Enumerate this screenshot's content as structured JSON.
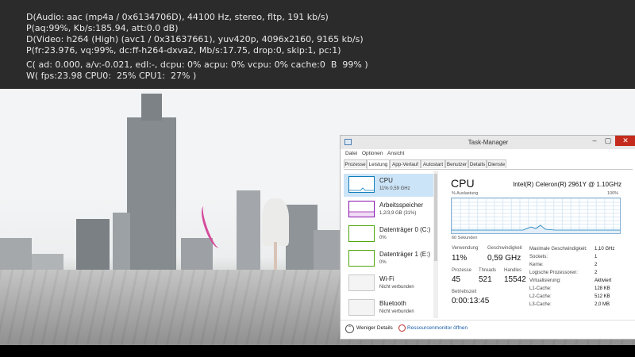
{
  "osd": {
    "line1": "D(Audio: aac (mp4a / 0x6134706D), 44100 Hz, stereo, fltp, 191 kb/s)",
    "line2": "P(aq:99%, Kb/s:185.94, att:0.0 dB)",
    "line3": "D(Video: h264 (High) (avc1 / 0x31637661), yuv420p, 4096x2160, 9165 kb/s)",
    "line4": "P(fr:23.976, vq:99%, dc:ff-h264-dxva2, Mb/s:17.75, drop:0, skip:1, pc:1)",
    "line5": "C( ad: 0.000, a/v:-0.021, edl:-, dcpu: 0% acpu: 0% vcpu: 0% cache:0  B  99% )",
    "line6": "W( fps:23.98 CPU0:  25% CPU1:  27% )"
  },
  "taskmanager": {
    "title": "Task-Manager",
    "window_buttons": {
      "minimize": "–",
      "maximize": "▢",
      "close": "✕"
    },
    "menu": [
      "Datei",
      "Optionen",
      "Ansicht"
    ],
    "tabs": [
      "Prozesse",
      "Leistung",
      "App-Verlauf",
      "Autostart",
      "Benutzer",
      "Details",
      "Dienste"
    ],
    "active_tab": "Leistung",
    "resources": [
      {
        "name": "CPU",
        "sub": "11% 0,59 GHz",
        "color": "#117dbb",
        "selected": true
      },
      {
        "name": "Arbeitsspeicher",
        "sub": "1,2/3,9 GB (31%)",
        "color": "#8b12ae",
        "selected": false
      },
      {
        "name": "Datenträger 0 (C:)",
        "sub": "0%",
        "color": "#4da60c",
        "selected": false
      },
      {
        "name": "Datenträger 1 (E:)",
        "sub": "0%",
        "color": "#4da60c",
        "selected": false
      },
      {
        "name": "Wi-Fi",
        "sub": "Nicht verbunden",
        "color": "#a74f01",
        "selected": false
      },
      {
        "name": "Bluetooth",
        "sub": "Nicht verbunden",
        "color": "#a74f01",
        "selected": false
      }
    ],
    "detail": {
      "title": "CPU",
      "model": "Intel(R) Celeron(R) 2961Y @ 1.10GHz",
      "graph_label": "% Auslastung",
      "graph_max": "100%",
      "graph_time": "60 Sekunden",
      "stats": {
        "usage_label": "Verwendung",
        "usage_value": "11%",
        "speed_label": "Geschwindigkeit",
        "speed_value": "0,59 GHz",
        "processes_label": "Prozesse",
        "processes_value": "45",
        "threads_label": "Threads",
        "threads_value": "521",
        "handles_label": "Handles",
        "handles_value": "15542",
        "uptime_label": "Betriebszeit",
        "uptime_value": "0:00:13:45"
      },
      "specs": [
        {
          "key": "Maximale Geschwindigkeit:",
          "value": "1,10 GHz"
        },
        {
          "key": "Sockets:",
          "value": "1"
        },
        {
          "key": "Kerne:",
          "value": "2"
        },
        {
          "key": "Logische Prozessoren:",
          "value": "2"
        },
        {
          "key": "Virtualisierung:",
          "value": "Aktiviert"
        },
        {
          "key": "L1-Cache:",
          "value": "128 KB"
        },
        {
          "key": "L2-Cache:",
          "value": "512 KB"
        },
        {
          "key": "L3-Cache:",
          "value": "2,0 MB"
        }
      ]
    },
    "footer": {
      "less_details": "Weniger Details",
      "resource_monitor": "Ressourcenmonitor öffnen"
    }
  }
}
